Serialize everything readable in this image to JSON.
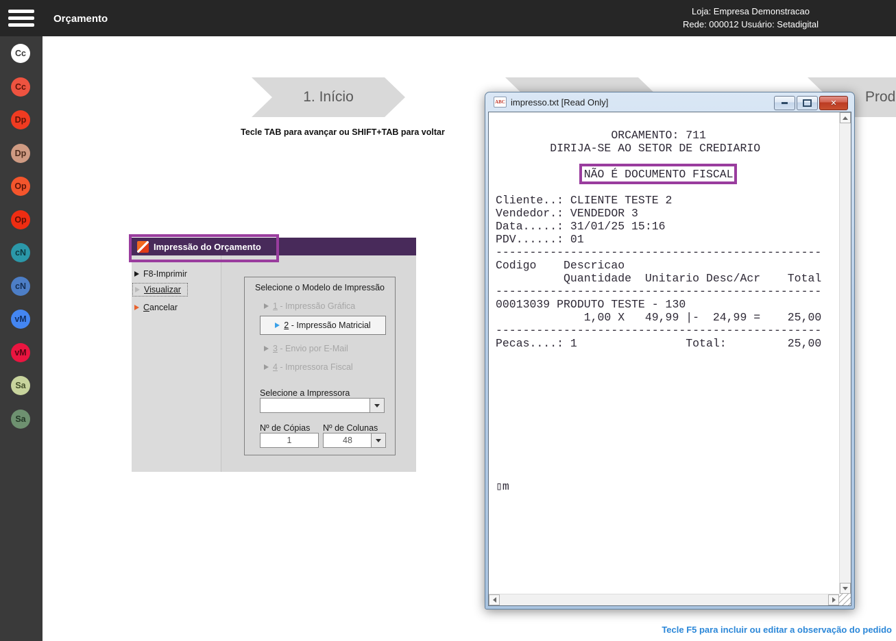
{
  "colors": {
    "topbar_bg": "#262626",
    "sidebar_bg": "#3a3a3a",
    "annotation": "#9a3d9e",
    "chevron_bg": "#d9d9d9",
    "dialog_header_bg": "#482a5a",
    "selected_option_arrow": "#3aa0e8",
    "receipt_text": "#2e2936",
    "footer_link": "#2b87d8"
  },
  "topbar": {
    "title": "Orçamento",
    "store_line": "Loja: Empresa Demonstracao",
    "network_line": "Rede: 000012 Usuário: Setadigital"
  },
  "sidebar": {
    "items": [
      {
        "label": "Cc",
        "bg": "#ffffff",
        "fg": "#3a3a3a"
      },
      {
        "label": "Cc",
        "bg": "#ee5340",
        "fg": "#5e1408"
      },
      {
        "label": "Dp",
        "bg": "#f03b21",
        "fg": "#5e1408"
      },
      {
        "label": "Dp",
        "bg": "#cf9b83",
        "fg": "#4e2d1e"
      },
      {
        "label": "Op",
        "bg": "#f4552c",
        "fg": "#5e1408"
      },
      {
        "label": "Op",
        "bg": "#ef2d12",
        "fg": "#5e0f06"
      },
      {
        "label": "cN",
        "bg": "#2b98a9",
        "fg": "#0d3a42"
      },
      {
        "label": "cN",
        "bg": "#4d7ec6",
        "fg": "#152f55"
      },
      {
        "label": "vM",
        "bg": "#4486f2",
        "fg": "#112f63"
      },
      {
        "label": "vM",
        "bg": "#ea1540",
        "fg": "#550514"
      },
      {
        "label": "Sa",
        "bg": "#c8d49d",
        "fg": "#44502a"
      },
      {
        "label": "Sa",
        "bg": "#6e9170",
        "fg": "#233826"
      }
    ]
  },
  "breadcrumb": {
    "step1": "1. Início",
    "step_partial": "Produ",
    "hint": "Tecle TAB para avançar ou SHIFT+TAB para voltar"
  },
  "print_dialog": {
    "title": "Impressão do Orçamento",
    "buttons": {
      "print": "F8-Imprimir",
      "preview": "Visualizar",
      "cancel_accel": "C",
      "cancel_rest": "ancelar"
    },
    "model_group": {
      "label": "Selecione o Modelo de Impressão",
      "options": [
        {
          "num": "1",
          "rest": " - Impressão Gráfica"
        },
        {
          "num": "2",
          "rest": " - Impressão Matricial"
        },
        {
          "num": "3",
          "rest": " - Envio por E-Mail"
        },
        {
          "num": "4",
          "rest": " - Impressora Fiscal"
        }
      ]
    },
    "printer_label": "Selecione a Impressora",
    "printer_value": "",
    "copies_label": "Nº de Cópias",
    "copies_value": "1",
    "columns_label": "Nº de Colunas",
    "columns_value": "48"
  },
  "notepad": {
    "title": "impresso.txt [Read Only]",
    "icon_label": "ABC",
    "content_lines": [
      "                 ORCAMENTO: 711",
      "        DIRIJA-SE AO SETOR DE CREDIARIO",
      "",
      "             NÃO É DOCUMENTO FISCAL",
      "",
      "Cliente..: CLIENTE TESTE 2",
      "Vendedor.: VENDEDOR 3",
      "Data.....: 31/01/25 15:16",
      "PDV......: 01",
      "------------------------------------------------",
      "Codigo    Descricao",
      "          Quantidade  Unitario Desc/Acr    Total",
      "------------------------------------------------",
      "00013039 PRODUTO TESTE - 130",
      "             1,00 X   49,99 |-  24,99 =    25,00",
      "------------------------------------------------",
      "Pecas....: 1                Total:         25,00",
      "",
      "",
      "",
      "",
      "",
      "",
      "",
      "",
      "",
      "",
      "▯m"
    ]
  },
  "footer": {
    "hint": "Tecle F5 para incluir ou editar a observação do pedido"
  }
}
